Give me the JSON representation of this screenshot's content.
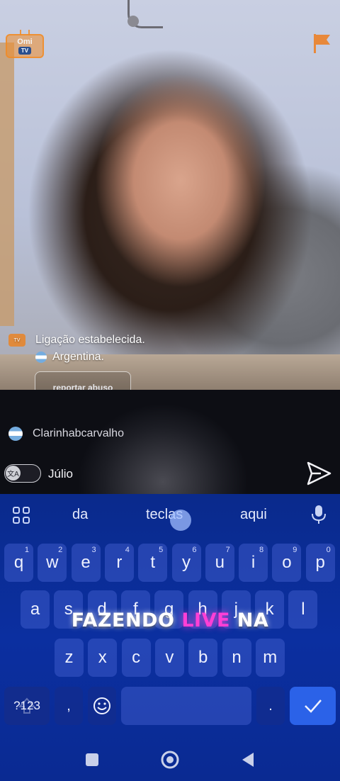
{
  "app": {
    "logo": {
      "line1": "Omi",
      "line2": "TV"
    }
  },
  "call": {
    "system_message": "Ligação estabelecida.",
    "country": "Argentina.",
    "report_button": "reportar abuso"
  },
  "chat": {
    "partner_name": "Clarinhabcarvalho",
    "input_value": "Júlio",
    "translate_icon": "translate-icon",
    "send_icon": "send-icon"
  },
  "keyboard": {
    "suggestions": [
      "da",
      "teclas",
      "aqui"
    ],
    "row1": [
      {
        "k": "q",
        "n": "1"
      },
      {
        "k": "w",
        "n": "2"
      },
      {
        "k": "e",
        "n": "3"
      },
      {
        "k": "r",
        "n": "4"
      },
      {
        "k": "t",
        "n": "5"
      },
      {
        "k": "y",
        "n": "6"
      },
      {
        "k": "u",
        "n": "7"
      },
      {
        "k": "i",
        "n": "8"
      },
      {
        "k": "o",
        "n": "9"
      },
      {
        "k": "p",
        "n": "0"
      }
    ],
    "row2": [
      "a",
      "s",
      "d",
      "f",
      "g",
      "h",
      "j",
      "k",
      "l"
    ],
    "row3": [
      "z",
      "x",
      "c",
      "v",
      "b",
      "n",
      "m"
    ],
    "symbols_key": "?123",
    "comma_key": ",",
    "period_key": ".",
    "colors": {
      "background": "#0b2fa0",
      "enter": "#2b62e8"
    }
  },
  "overlay": {
    "banner_part1": "FAZENDO ",
    "banner_live": "LIVE",
    "banner_part2": " NA",
    "live_color": "#ff3fd6"
  }
}
